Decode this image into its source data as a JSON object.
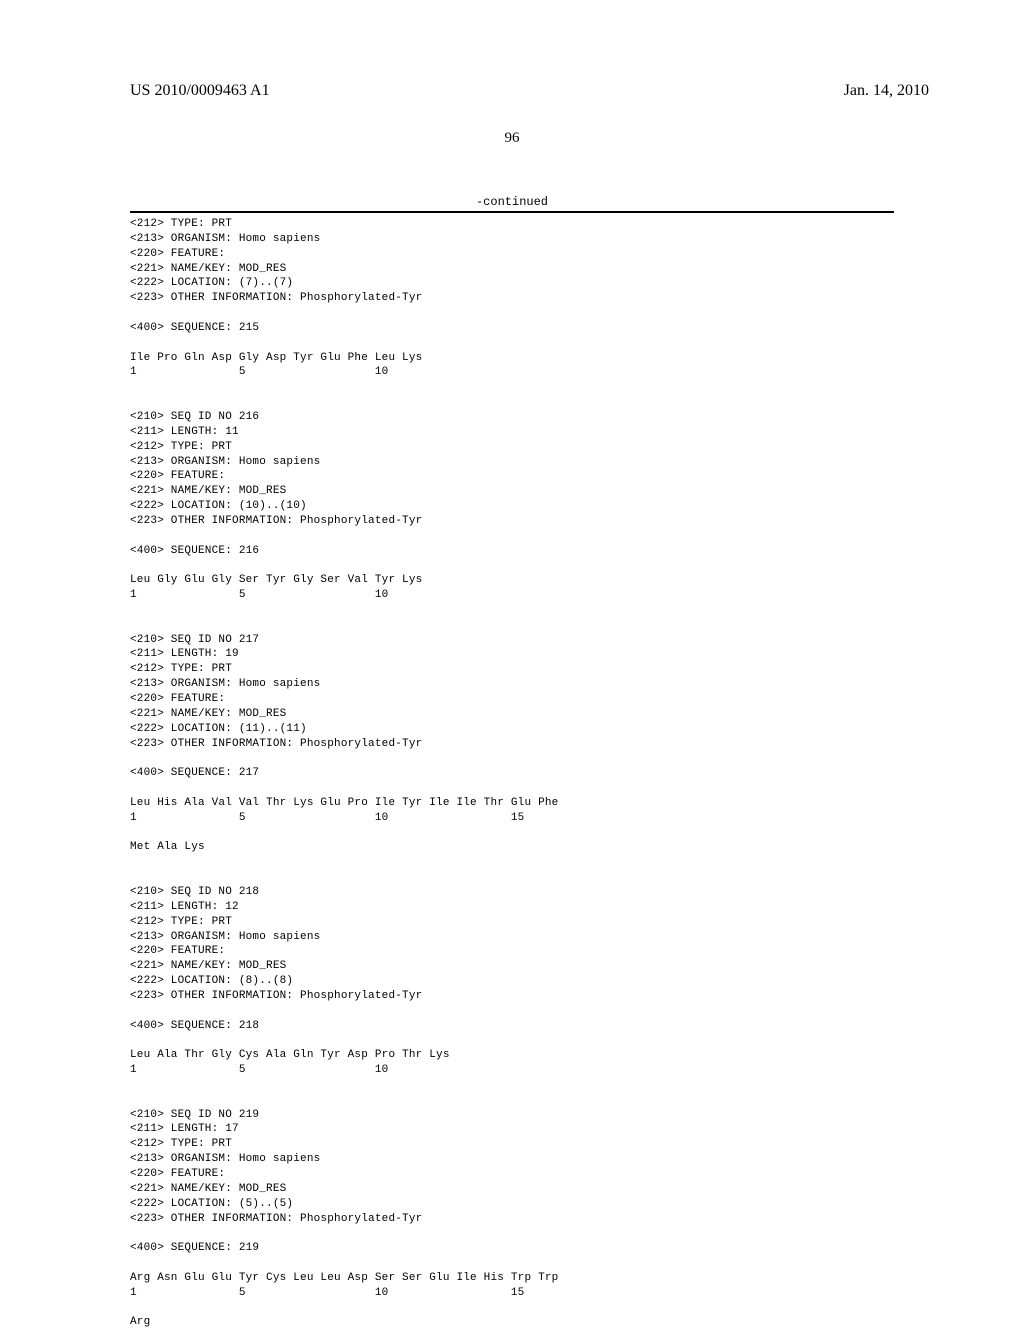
{
  "header": {
    "pub_number": "US 2010/0009463 A1",
    "pub_date": "Jan. 14, 2010"
  },
  "page_number": "96",
  "continued_label": "-continued",
  "sequence_text": "<212> TYPE: PRT\n<213> ORGANISM: Homo sapiens\n<220> FEATURE:\n<221> NAME/KEY: MOD_RES\n<222> LOCATION: (7)..(7)\n<223> OTHER INFORMATION: Phosphorylated-Tyr\n\n<400> SEQUENCE: 215\n\nIle Pro Gln Asp Gly Asp Tyr Glu Phe Leu Lys\n1               5                   10\n\n\n<210> SEQ ID NO 216\n<211> LENGTH: 11\n<212> TYPE: PRT\n<213> ORGANISM: Homo sapiens\n<220> FEATURE:\n<221> NAME/KEY: MOD_RES\n<222> LOCATION: (10)..(10)\n<223> OTHER INFORMATION: Phosphorylated-Tyr\n\n<400> SEQUENCE: 216\n\nLeu Gly Glu Gly Ser Tyr Gly Ser Val Tyr Lys\n1               5                   10\n\n\n<210> SEQ ID NO 217\n<211> LENGTH: 19\n<212> TYPE: PRT\n<213> ORGANISM: Homo sapiens\n<220> FEATURE:\n<221> NAME/KEY: MOD_RES\n<222> LOCATION: (11)..(11)\n<223> OTHER INFORMATION: Phosphorylated-Tyr\n\n<400> SEQUENCE: 217\n\nLeu His Ala Val Val Thr Lys Glu Pro Ile Tyr Ile Ile Thr Glu Phe\n1               5                   10                  15\n\nMet Ala Lys\n\n\n<210> SEQ ID NO 218\n<211> LENGTH: 12\n<212> TYPE: PRT\n<213> ORGANISM: Homo sapiens\n<220> FEATURE:\n<221> NAME/KEY: MOD_RES\n<222> LOCATION: (8)..(8)\n<223> OTHER INFORMATION: Phosphorylated-Tyr\n\n<400> SEQUENCE: 218\n\nLeu Ala Thr Gly Cys Ala Gln Tyr Asp Pro Thr Lys\n1               5                   10\n\n\n<210> SEQ ID NO 219\n<211> LENGTH: 17\n<212> TYPE: PRT\n<213> ORGANISM: Homo sapiens\n<220> FEATURE:\n<221> NAME/KEY: MOD_RES\n<222> LOCATION: (5)..(5)\n<223> OTHER INFORMATION: Phosphorylated-Tyr\n\n<400> SEQUENCE: 219\n\nArg Asn Glu Glu Tyr Cys Leu Leu Asp Ser Ser Glu Ile His Trp Trp\n1               5                   10                  15\n\nArg"
}
